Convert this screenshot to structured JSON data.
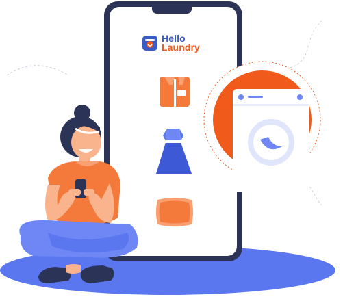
{
  "brand": {
    "line1": "Hello",
    "line2": "Laundry",
    "icon": "washing-basket-icon"
  },
  "items": [
    {
      "icon": "shirt-icon"
    },
    {
      "icon": "dress-icon"
    },
    {
      "icon": "pillow-icon"
    }
  ],
  "colors": {
    "accent_orange": "#f05a1a",
    "brand_blue": "#3a5cc6",
    "floor_blue": "#5b77f0",
    "phone_frame": "#2b3356"
  }
}
